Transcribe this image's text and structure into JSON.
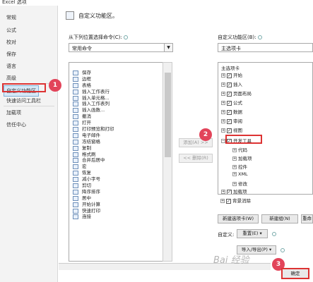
{
  "window": {
    "title": "Excel 选项"
  },
  "sidebar": {
    "items": [
      {
        "label": "常规"
      },
      {
        "label": "公式"
      },
      {
        "label": "校对"
      },
      {
        "label": "保存"
      },
      {
        "label": "语言"
      },
      {
        "label": "高级"
      },
      {
        "label": "自定义功能区"
      },
      {
        "label": "快速访问工具栏"
      },
      {
        "label": "加载项"
      },
      {
        "label": "信任中心"
      }
    ],
    "active_index": 6
  },
  "callouts": {
    "one": "1",
    "two": "2",
    "three": "3"
  },
  "header": {
    "title": "自定义功能区。"
  },
  "left_panel": {
    "label": "从下列位置选择命令(C):",
    "select_value": "常用命令",
    "commands": [
      "保存",
      "边框",
      "表格",
      "插入工作表行",
      "插入单元格...",
      "插入工作表列",
      "插入函数...",
      "撤消",
      "打开",
      "打印预览和打印",
      "电子邮件",
      "冻结窗格",
      "复制",
      "格式刷",
      "合并后居中",
      "宏",
      "恢复",
      "减小字号",
      "剪切",
      "降序排序",
      "居中",
      "开始计算",
      "快速打印",
      "连接"
    ]
  },
  "middle_buttons": {
    "add": "添加(A) >>",
    "remove": "<< 删除(R)"
  },
  "right_panel": {
    "label": "自定义功能区(B):",
    "select_value": "主选项卡",
    "tree_header": "主选项卡",
    "tabs": [
      {
        "label": "开始",
        "checked": true
      },
      {
        "label": "插入",
        "checked": true
      },
      {
        "label": "页面布局",
        "checked": true
      },
      {
        "label": "公式",
        "checked": true
      },
      {
        "label": "数据",
        "checked": true
      },
      {
        "label": "审阅",
        "checked": true
      },
      {
        "label": "视图",
        "checked": true
      },
      {
        "label": "开发工具",
        "checked": true
      }
    ],
    "dev_children": [
      "代码",
      "加载项",
      "控件",
      "XML",
      "修改"
    ],
    "after_tabs": [
      {
        "label": "加载项",
        "checked": true
      },
      {
        "label": "背景消除",
        "checked": true
      }
    ]
  },
  "bottom_buttons": {
    "new_tab": "新建选项卡(W)",
    "new_group": "新建组(N)",
    "rename": "重命",
    "customize_label": "自定义:",
    "reset": "重置(E) ▾",
    "import_export": "导入/导出(P) ▾",
    "ok": "确定"
  },
  "watermark": {
    "text": "Bai 经验"
  }
}
